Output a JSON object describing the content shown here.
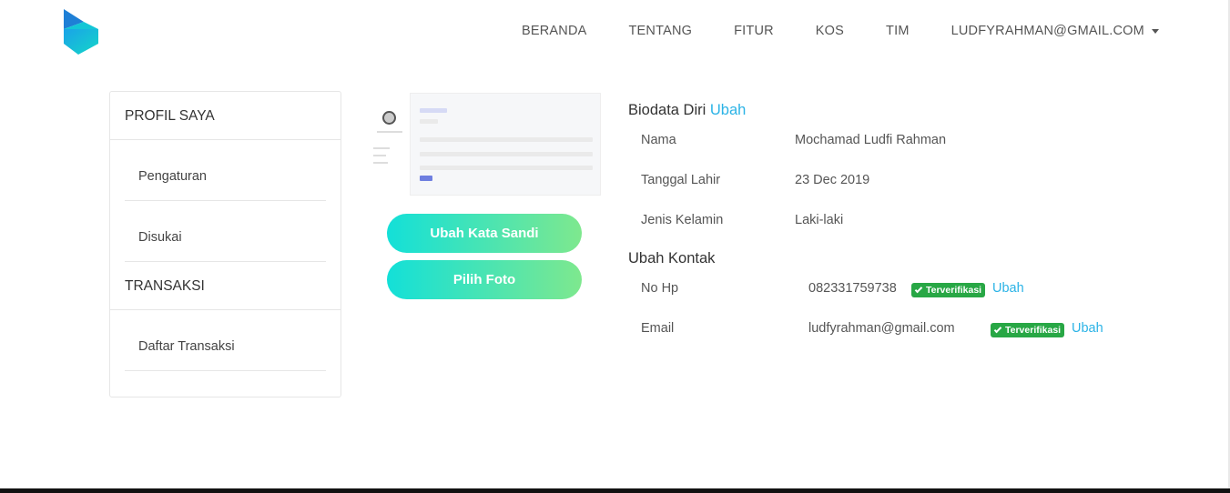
{
  "nav": {
    "items": [
      "BERANDA",
      "TENTANG",
      "FITUR",
      "KOS",
      "TIM"
    ],
    "user": "LUDFYRAHMAN@GMAIL.COM"
  },
  "sidebar": {
    "profile_header": "PROFIL SAYA",
    "profile_items": [
      "Pengaturan",
      "Disukai"
    ],
    "transaction_header": "TRANSAKSI",
    "transaction_items": [
      "Daftar Transaksi"
    ]
  },
  "buttons": {
    "change_password": "Ubah Kata Sandi",
    "choose_photo": "Pilih Foto"
  },
  "biodata": {
    "title": "Biodata Diri",
    "edit_link": "Ubah",
    "rows": [
      {
        "label": "Nama",
        "value": "Mochamad Ludfi Rahman"
      },
      {
        "label": "Tanggal Lahir",
        "value": "23 Dec 2019"
      },
      {
        "label": "Jenis Kelamin",
        "value": "Laki-laki"
      }
    ]
  },
  "contact": {
    "title": "Ubah Kontak",
    "rows": [
      {
        "label": "No Hp",
        "value": "082331759738",
        "badge": "Terverifikasi",
        "link": "Ubah"
      },
      {
        "label": "Email",
        "value": "ludfyrahman@gmail.com",
        "badge": "Terverifikasi",
        "link": "Ubah"
      }
    ]
  },
  "colors": {
    "accent_link": "#2bb3e6",
    "verified_badge": "#28a745",
    "gradient_start": "#13e0d8",
    "gradient_end": "#7ee88e"
  }
}
